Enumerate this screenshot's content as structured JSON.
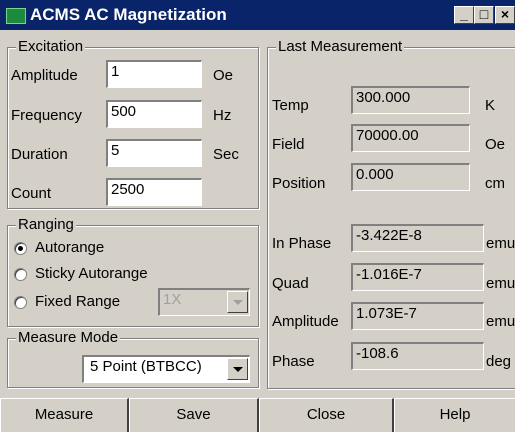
{
  "window": {
    "title": "ACMS AC Magnetization",
    "minimize": "_",
    "maximize": "□",
    "close": "×"
  },
  "excitation": {
    "legend": "Excitation",
    "rows": [
      {
        "label": "Amplitude",
        "value": "1",
        "unit": "Oe"
      },
      {
        "label": "Frequency",
        "value": "500",
        "unit": "Hz"
      },
      {
        "label": "Duration",
        "value": "5",
        "unit": "Sec"
      },
      {
        "label": "Count",
        "value": "2500",
        "unit": ""
      }
    ]
  },
  "ranging": {
    "legend": "Ranging",
    "options": [
      {
        "label": "Autorange",
        "checked": true
      },
      {
        "label": "Sticky Autorange",
        "checked": false
      },
      {
        "label": "Fixed Range",
        "checked": false
      }
    ],
    "fixed_range_value": "1X"
  },
  "measure_mode": {
    "legend": "Measure Mode",
    "value": "5 Point (BTBCC)"
  },
  "last_measurement": {
    "legend": "Last Measurement",
    "rows": [
      {
        "label": "Temp",
        "value": "300.000",
        "unit": "K"
      },
      {
        "label": "Field",
        "value": "70000.00",
        "unit": "Oe"
      },
      {
        "label": "Position",
        "value": "0.000",
        "unit": "cm"
      },
      {
        "label": "In Phase",
        "value": "-3.422E-8",
        "unit": "emu"
      },
      {
        "label": "Quad",
        "value": "-1.016E-7",
        "unit": "emu"
      },
      {
        "label": "Amplitude",
        "value": "1.073E-7",
        "unit": "emu"
      },
      {
        "label": "Phase",
        "value": "-108.6",
        "unit": "deg"
      }
    ]
  },
  "buttons": {
    "measure": "Measure",
    "save": "Save",
    "close": "Close",
    "help": "Help"
  }
}
